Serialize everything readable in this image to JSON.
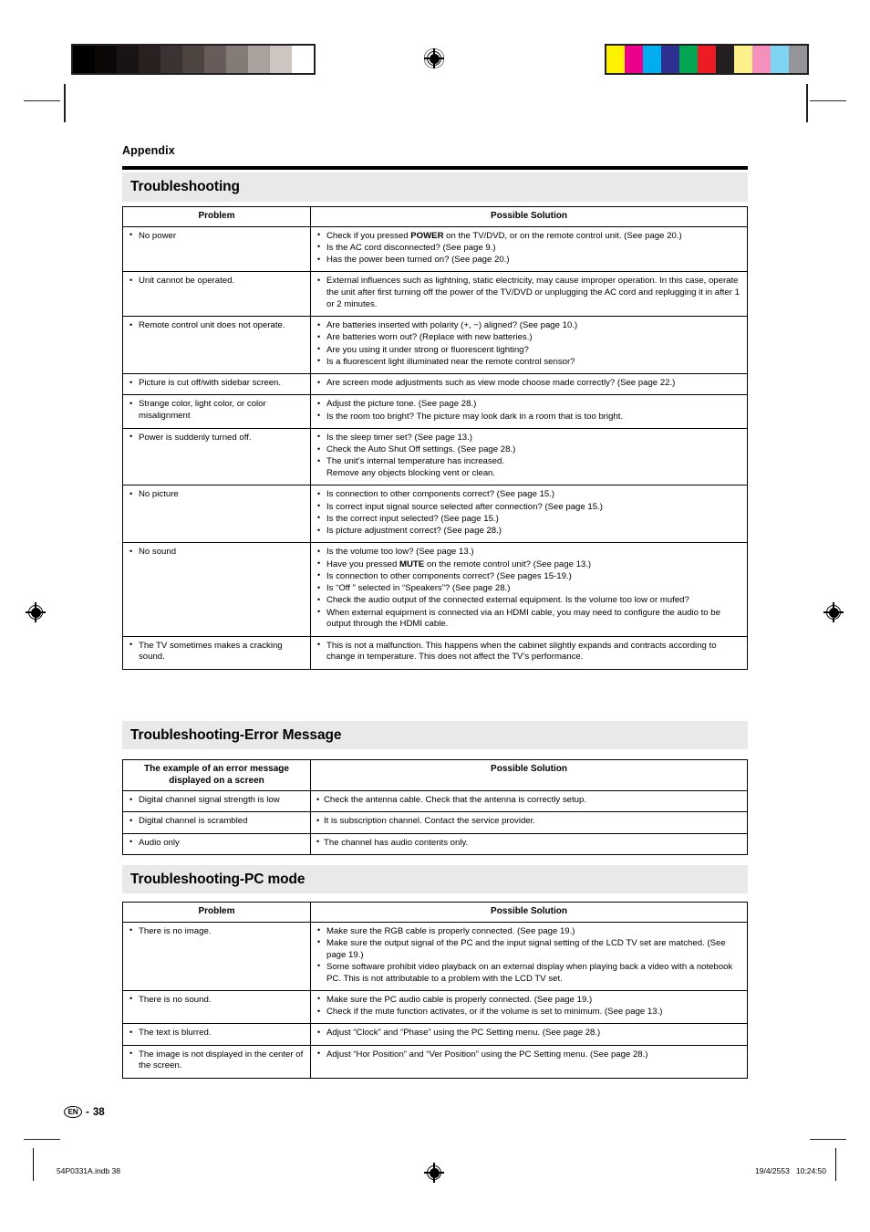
{
  "page": {
    "running_head": "Appendix",
    "page_number_label": "38",
    "language_badge": "EN",
    "page_number_separator": "-"
  },
  "calibration": {
    "gray_ramp": [
      "#000000",
      "#0b0807",
      "#191413",
      "#282120",
      "#3b3331",
      "#4e4442",
      "#675c59",
      "#847a76",
      "#a9a19d",
      "#cdc5c1",
      "#ffffff"
    ],
    "color_bars": [
      "#fff200",
      "#ec008c",
      "#00aeef",
      "#2e3192",
      "#00a651",
      "#ed1c24",
      "#231f20",
      "#fbf08a",
      "#f590bd",
      "#7fd4f4",
      "#939598"
    ]
  },
  "sections": [
    {
      "title": "Troubleshooting",
      "columns": [
        "Problem",
        "Possible Solution"
      ],
      "rows": [
        {
          "problem": [
            "No power"
          ],
          "solutions": [
            "Check if you pressed POWER on the TV/DVD, or on the remote control unit. (See page 20.)",
            "Is the AC cord disconnected? (See page 9.)",
            "Has the power been turned on? (See page 20.)"
          ]
        },
        {
          "problem": [
            "Unit cannot be operated."
          ],
          "solutions": [
            "External influences such as lightning, static electricity, may cause improper operation. In this case, operate the unit after first turning off the power of the TV/DVD or unplugging the AC cord and replugging it in after 1 or 2 minutes."
          ]
        },
        {
          "problem": [
            "Remote control unit does not operate."
          ],
          "solutions": [
            "Are batteries inserted with polarity (+, −) aligned? (See page 10.)",
            "Are batteries worn out? (Replace with new batteries.)",
            "Are you using it under strong or fluorescent lighting?",
            "Is a fluorescent light illuminated near the remote control sensor?"
          ]
        },
        {
          "problem": [
            "Picture is cut off/with sidebar screen."
          ],
          "solutions": [
            "Are screen mode adjustments such as view mode choose made correctly? (See page 22.)"
          ]
        },
        {
          "problem": [
            "Strange color, light color, or color misalignment"
          ],
          "solutions": [
            "Adjust the picture tone. (See page 28.)",
            "Is the room too bright? The picture may look dark in a room that is too bright."
          ]
        },
        {
          "problem": [
            "Power is suddenly turned off."
          ],
          "solutions": [
            "Is the sleep timer set? (See page 13.)",
            "Check the Auto Shut Off settings. (See page 28.)",
            "The unit’s internal temperature has increased.\nRemove any objects blocking vent or clean."
          ]
        },
        {
          "problem": [
            "No picture"
          ],
          "solutions": [
            "Is connection to other components correct? (See page 15.)",
            "Is correct input signal source selected after connection? (See page 15.)",
            "Is the correct input selected? (See page 15.)",
            "Is picture adjustment correct? (See page 28.)"
          ]
        },
        {
          "problem": [
            "No sound"
          ],
          "solutions": [
            "Is the volume too low? (See page 13.)",
            "Have you pressed MUTE on the remote control unit? (See page 13.)",
            "Is connection to other components correct? (See pages 15-19.)",
            "Is “Off ” selected in “Speakers”? (See page 28.)",
            "Check the audio output of the connected external equipment. Is the volume too low or mufed?",
            "When external equiprnent is connected via an HDMI cable, you may need to configure the audio to be output through the HDMI cable."
          ]
        },
        {
          "problem": [
            "The TV sometimes makes a cracking sound."
          ],
          "solutions": [
            "This is not a malfunction. This happens when the cabinet slightly expands and contracts according to change in temperature. This does not affect the TV’s performance."
          ]
        }
      ]
    },
    {
      "title": "Troubleshooting-Error Message",
      "columns": [
        "The example of an error message displayed on a screen",
        "Possible Solution"
      ],
      "rows": [
        {
          "problem": [
            "Digital channel signal strength is low"
          ],
          "solutions": [
            "Check the antenna cable. Check that the antenna is correctly setup."
          ]
        },
        {
          "problem": [
            "Digital channel is scrambled"
          ],
          "solutions": [
            "It is subscription channel. Contact the service provider."
          ]
        },
        {
          "problem": [
            "Audio only"
          ],
          "solutions": [
            "The channel has audio contents only."
          ]
        }
      ]
    },
    {
      "title": "Troubleshooting-PC mode",
      "columns": [
        "Problem",
        "Possible Solution"
      ],
      "rows": [
        {
          "problem": [
            "There is no image."
          ],
          "solutions": [
            "Make sure the RGB cable is properly connected. (See page 19.)",
            "Make sure the output signal of the PC and the input signal setting of the LCD TV set are matched. (See page 19.)",
            "Some software prohibit video playback on an external display when playing back a video with a notebook PC. This is not attributable to a problem with the LCD TV set."
          ]
        },
        {
          "problem": [
            "There is no sound."
          ],
          "solutions": [
            "Make sure the PC audio cable is properly connected. (See page 19.)",
            "Check if the mute function activates, or if the volume is set to minimum. (See page 13.)"
          ]
        },
        {
          "problem": [
            "The text is blurred."
          ],
          "solutions": [
            "Adjust “Clock” and “Phase” using the PC Setting menu. (See page 28.)"
          ]
        },
        {
          "problem": [
            "The image is not displayed in the center of the screen."
          ],
          "solutions": [
            "Adjust “Hor Position” and “Ver Position” using the PC Setting menu. (See page 28.)"
          ]
        }
      ]
    }
  ],
  "footer": {
    "file_name": "54P0331A.indb   38",
    "timestamp": "19/4/2553   10:24:50"
  }
}
